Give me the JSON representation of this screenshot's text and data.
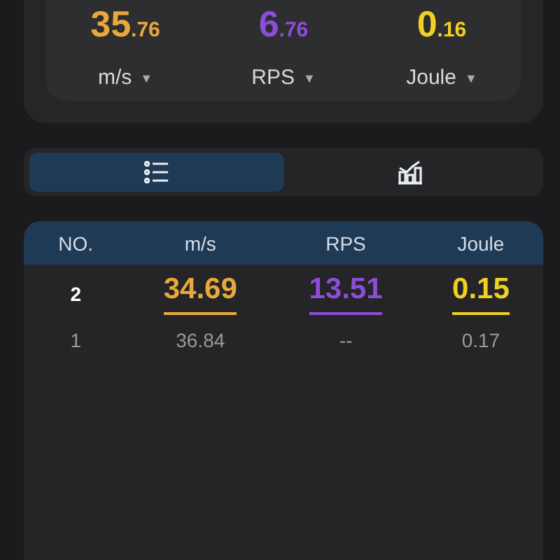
{
  "readouts": [
    {
      "whole": "35",
      "fraction": ".76",
      "unit": "m/s",
      "caret": "▼",
      "color": "#e8a83a"
    },
    {
      "whole": "6",
      "fraction": ".76",
      "unit": "RPS",
      "caret": "▼",
      "color": "#8a4fd6"
    },
    {
      "whole": "0",
      "fraction": ".16",
      "unit": "Joule",
      "caret": "▼",
      "color": "#f0d020"
    }
  ],
  "tabs": [
    {
      "kind": "list",
      "selected": true
    },
    {
      "kind": "chart",
      "selected": false
    }
  ],
  "table": {
    "columns": [
      "NO.",
      "m/s",
      "RPS",
      "Joule"
    ],
    "rows": [
      {
        "highlighted": true,
        "cells": [
          "2",
          "34.69",
          "13.51",
          "0.15"
        ]
      },
      {
        "highlighted": false,
        "cells": [
          "1",
          "36.84",
          "--",
          "0.17"
        ]
      }
    ]
  }
}
